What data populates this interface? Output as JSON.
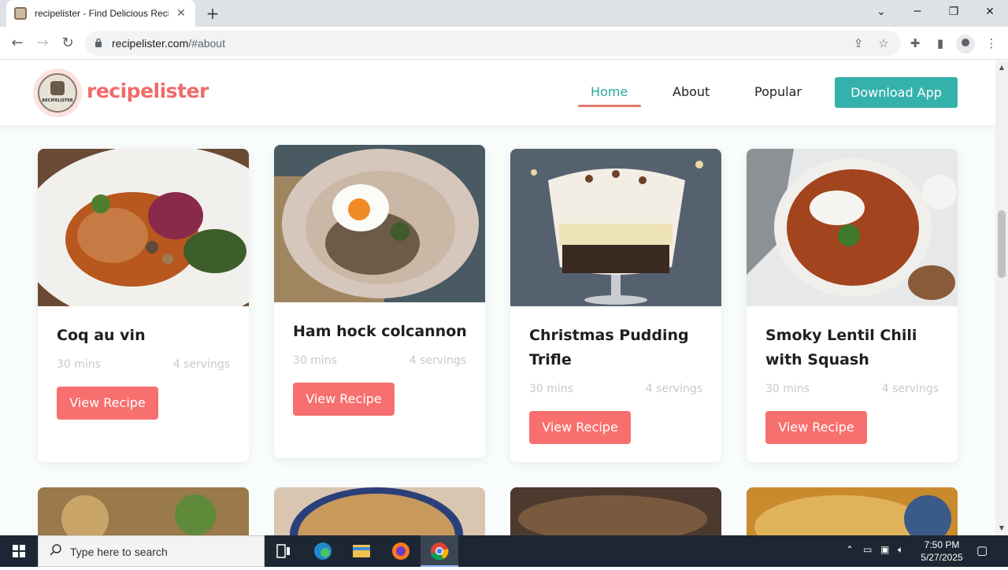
{
  "browser": {
    "tab_title": "recipelister - Find Delicious Recip",
    "url_domain": "recipelister.com",
    "url_path": "/#about"
  },
  "site": {
    "brand": "recipelister",
    "logo_text": "RECIPELISTER",
    "nav": [
      "Home",
      "About",
      "Popular"
    ],
    "download_label": "Download App"
  },
  "cards": [
    {
      "title": "Coq au vin",
      "time": "30 mins",
      "servings": "4 servings",
      "button": "View Recipe"
    },
    {
      "title": "Ham hock colcannon",
      "time": "30 mins",
      "servings": "4 servings",
      "button": "View Recipe"
    },
    {
      "title": "Christmas Pudding Trifle",
      "time": "30 mins",
      "servings": "4 servings",
      "button": "View Recipe"
    },
    {
      "title": "Smoky Lentil Chili with Squash",
      "time": "30 mins",
      "servings": "4 servings",
      "button": "View Recipe"
    }
  ],
  "taskbar": {
    "search_placeholder": "Type here to search",
    "time": "7:50 PM",
    "date": "5/27/2025"
  },
  "colors": {
    "brand": "#f06b6b",
    "accent": "#35b1ab",
    "button": "#f76f6f"
  }
}
